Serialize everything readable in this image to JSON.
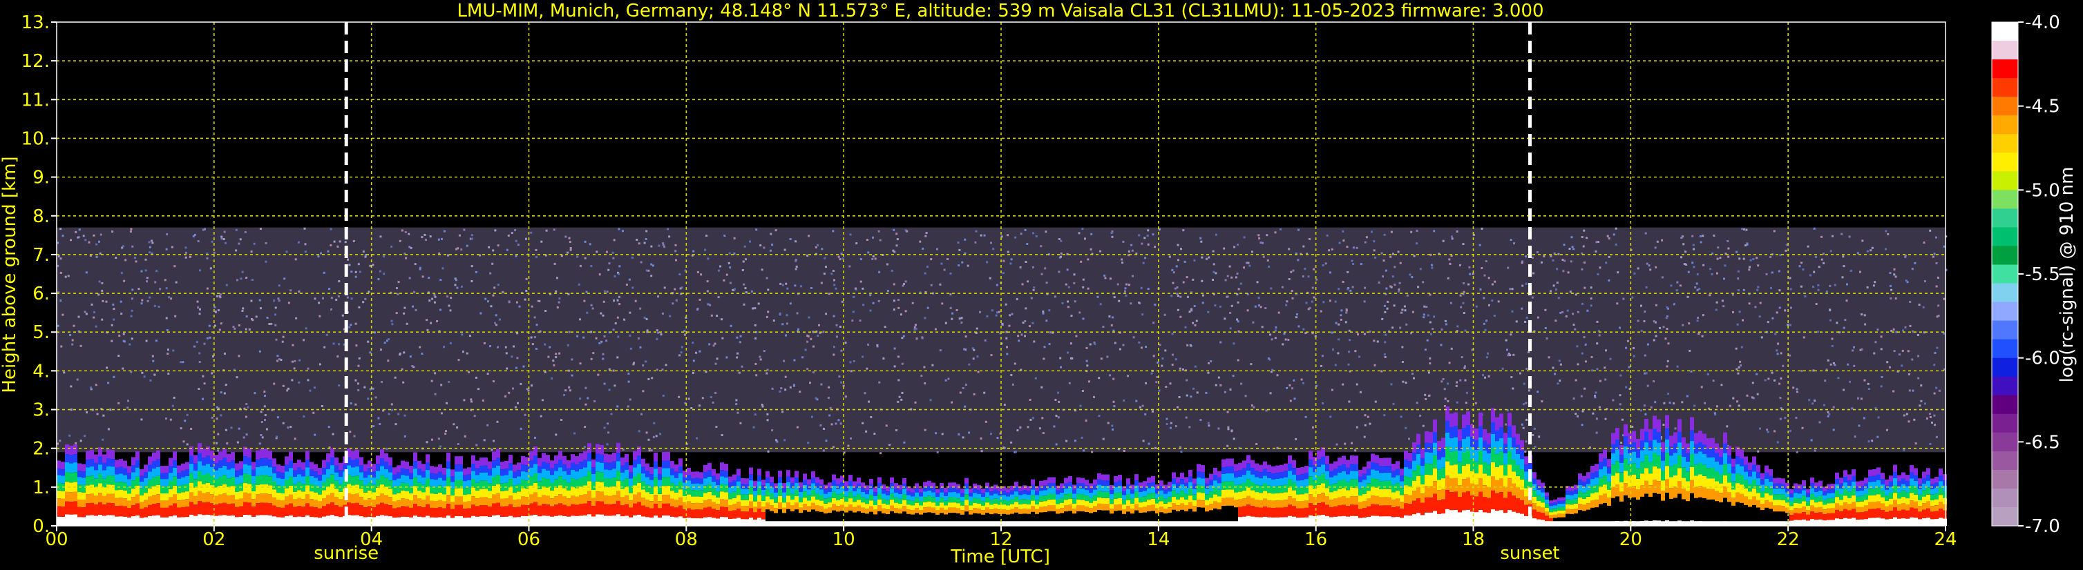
{
  "chart_data": {
    "type": "heatmap",
    "title": "LMU-MIM, Munich, Germany; 48.148° N 11.573° E, altitude: 539 m    Vaisala CL31 (CL31LMU): 11-05-2023    firmware: 3.000",
    "xlabel": "Time [UTC]",
    "ylabel": "Height above ground [km]",
    "xlim": [
      0,
      24
    ],
    "ylim": [
      0,
      13
    ],
    "x_ticks": [
      "00",
      "02",
      "04",
      "06",
      "08",
      "10",
      "12",
      "14",
      "16",
      "18",
      "20",
      "22",
      "24"
    ],
    "y_ticks": [
      "0.",
      "1.",
      "2.",
      "3.",
      "4.",
      "5.",
      "6.",
      "7.",
      "8.",
      "9.",
      "10.",
      "11.",
      "12.",
      "13."
    ],
    "grid": true,
    "colorbar": {
      "label": "log(rc-signal) @ 910 nm",
      "range": [
        -7.0,
        -4.0
      ],
      "ticks": [
        "-4.0",
        "-4.5",
        "-5.0",
        "-5.5",
        "-6.0",
        "-6.5",
        "-7.0"
      ]
    },
    "markers": [
      {
        "label": "sunrise",
        "time": 3.68
      },
      {
        "label": "sunset",
        "time": 18.72
      }
    ],
    "noise_top_km": 7.7,
    "backscatter_layer_top_km": [
      {
        "time": 0,
        "top": 1.9
      },
      {
        "time": 1,
        "top": 1.7
      },
      {
        "time": 2,
        "top": 1.9
      },
      {
        "time": 3,
        "top": 1.7
      },
      {
        "time": 4,
        "top": 1.8
      },
      {
        "time": 5,
        "top": 1.7
      },
      {
        "time": 6,
        "top": 1.8
      },
      {
        "time": 7,
        "top": 1.9
      },
      {
        "time": 8,
        "top": 1.6
      },
      {
        "time": 9,
        "top": 1.3
      },
      {
        "time": 10,
        "top": 1.2
      },
      {
        "time": 11,
        "top": 1.1
      },
      {
        "time": 12,
        "top": 1.1
      },
      {
        "time": 13,
        "top": 1.2
      },
      {
        "time": 14,
        "top": 1.2
      },
      {
        "time": 15,
        "top": 1.6
      },
      {
        "time": 16,
        "top": 1.8
      },
      {
        "time": 17,
        "top": 1.6
      },
      {
        "time": 17.7,
        "top": 2.8
      },
      {
        "time": 18.5,
        "top": 2.6
      },
      {
        "time": 19,
        "top": 0.6
      },
      {
        "time": 20,
        "top": 2.6
      },
      {
        "time": 21,
        "top": 2.4
      },
      {
        "time": 22,
        "top": 1.0
      },
      {
        "time": 23,
        "top": 1.4
      },
      {
        "time": 24,
        "top": 1.4
      }
    ]
  }
}
